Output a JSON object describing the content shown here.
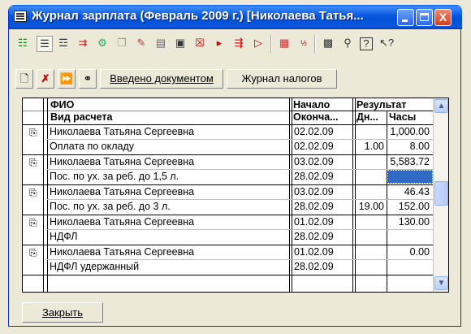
{
  "window": {
    "title": "Журнал зарплата (Февраль 2009 г.) [Николаева Татья...",
    "controls": {
      "minimize": "_",
      "maximize": "□",
      "close": "X"
    }
  },
  "toolbar2": {
    "entered_by_document": "Введено документом",
    "tax_journal": "Журнал налогов"
  },
  "table": {
    "headers": {
      "fio": "ФИО",
      "calc_type": "Вид расчета",
      "start": "Начало",
      "end": "Оконча...",
      "result": "Результат",
      "days": "Дн...",
      "hours": "Часы"
    },
    "rows": [
      {
        "fio": "Николаева Татьяна Сергеевна",
        "calc_type": "Оплата по окладу",
        "start": "02.02.09",
        "end": "02.02.09",
        "result": "1,000.00",
        "days": "1.00",
        "hours": "8.00"
      },
      {
        "fio": "Николаева Татьяна Сергеевна",
        "calc_type": "Пос. по ух. за реб. до 1,5 л.",
        "start": "03.02.09",
        "end": "28.02.09",
        "result": "5,583.72",
        "days": "",
        "hours": ""
      },
      {
        "fio": "Николаева Татьяна Сергеевна",
        "calc_type": "Пос. по ух. за реб. до 3 л.",
        "start": "03.02.09",
        "end": "28.02.09",
        "result": "46.43",
        "days": "19.00",
        "hours": "152.00"
      },
      {
        "fio": "Николаева Татьяна Сергеевна",
        "calc_type": "НДФЛ",
        "start": "01.02.09",
        "end": "28.02.09",
        "result": "130.00",
        "days": "",
        "hours": ""
      },
      {
        "fio": "Николаева Татьяна Сергеевна",
        "calc_type": "НДФЛ удержанный",
        "start": "01.02.09",
        "end": "28.02.09",
        "result": "0.00",
        "days": "",
        "hours": ""
      }
    ]
  },
  "close_button": "Закрыть"
}
